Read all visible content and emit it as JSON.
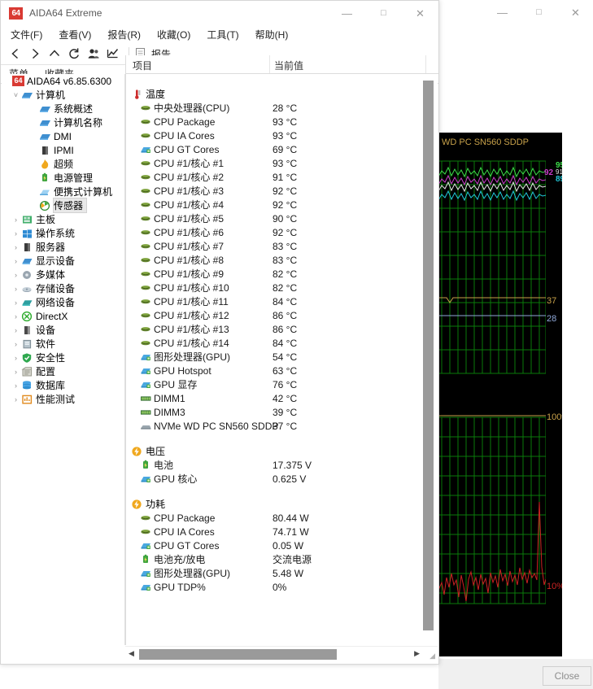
{
  "app_window": {
    "title": "AIDA64 Extreme",
    "icon_badge": "64",
    "window_controls": {
      "minimize": "minimize-icon",
      "maximize": "maximize-icon",
      "close": "close-icon"
    },
    "menubar": [
      "文件(F)",
      "查看(V)",
      "报告(R)",
      "收藏(O)",
      "工具(T)",
      "帮助(H)"
    ],
    "toolbar": {
      "buttons": [
        "back-icon",
        "forward-icon",
        "up-icon",
        "refresh-icon",
        "user-icon",
        "chart-icon"
      ],
      "report_label": "报告"
    },
    "tabs": [
      "菜单",
      "收藏夹"
    ],
    "columns": [
      "项目",
      "当前值"
    ]
  },
  "sidebar": {
    "root": {
      "label": "AIDA64 v6.85.6300",
      "badge": "64"
    },
    "items": [
      {
        "label": "计算机",
        "indent": 1,
        "twisty": "expanded",
        "icon": "computer-icon",
        "selected": false
      },
      {
        "label": "系统概述",
        "indent": 3,
        "twisty": "",
        "icon": "computer-icon",
        "selected": false
      },
      {
        "label": "计算机名称",
        "indent": 3,
        "twisty": "",
        "icon": "computer-icon",
        "selected": false
      },
      {
        "label": "DMI",
        "indent": 3,
        "twisty": "",
        "icon": "computer-icon",
        "selected": false
      },
      {
        "label": "IPMI",
        "indent": 3,
        "twisty": "",
        "icon": "server-icon",
        "selected": false
      },
      {
        "label": "超频",
        "indent": 3,
        "twisty": "",
        "icon": "flame-icon",
        "selected": false
      },
      {
        "label": "电源管理",
        "indent": 3,
        "twisty": "",
        "icon": "battery-icon",
        "selected": false
      },
      {
        "label": "便携式计算机",
        "indent": 3,
        "twisty": "",
        "icon": "laptop-icon",
        "selected": false
      },
      {
        "label": "传感器",
        "indent": 3,
        "twisty": "",
        "icon": "sensor-icon",
        "selected": true
      },
      {
        "label": "主板",
        "indent": 1,
        "twisty": "collapsed",
        "icon": "mainboard-icon",
        "selected": false
      },
      {
        "label": "操作系统",
        "indent": 1,
        "twisty": "collapsed",
        "icon": "windows-icon",
        "selected": false
      },
      {
        "label": "服务器",
        "indent": 1,
        "twisty": "collapsed",
        "icon": "server-icon",
        "selected": false
      },
      {
        "label": "显示设备",
        "indent": 1,
        "twisty": "collapsed",
        "icon": "display-icon",
        "selected": false
      },
      {
        "label": "多媒体",
        "indent": 1,
        "twisty": "collapsed",
        "icon": "audio-icon",
        "selected": false
      },
      {
        "label": "存储设备",
        "indent": 1,
        "twisty": "collapsed",
        "icon": "storage-icon",
        "selected": false
      },
      {
        "label": "网络设备",
        "indent": 1,
        "twisty": "collapsed",
        "icon": "network-icon",
        "selected": false
      },
      {
        "label": "DirectX",
        "indent": 1,
        "twisty": "collapsed",
        "icon": "directx-icon",
        "selected": false
      },
      {
        "label": "设备",
        "indent": 1,
        "twisty": "collapsed",
        "icon": "device-icon",
        "selected": false
      },
      {
        "label": "软件",
        "indent": 1,
        "twisty": "collapsed",
        "icon": "software-icon",
        "selected": false
      },
      {
        "label": "安全性",
        "indent": 1,
        "twisty": "collapsed",
        "icon": "shield-icon",
        "selected": false
      },
      {
        "label": "配置",
        "indent": 1,
        "twisty": "collapsed",
        "icon": "config-icon",
        "selected": false
      },
      {
        "label": "数据库",
        "indent": 1,
        "twisty": "collapsed",
        "icon": "database-icon",
        "selected": false
      },
      {
        "label": "性能测试",
        "indent": 1,
        "twisty": "collapsed",
        "icon": "benchmark-icon",
        "selected": false
      }
    ]
  },
  "sensor_list": [
    {
      "group": "温度",
      "group_icon": "thermometer-icon",
      "rows": [
        {
          "name": "中央处理器(CPU)",
          "value": "28 °C",
          "icon": "cpu-icon"
        },
        {
          "name": "CPU Package",
          "value": "93 °C",
          "icon": "cpu-icon"
        },
        {
          "name": "CPU IA Cores",
          "value": "93 °C",
          "icon": "cpu-icon"
        },
        {
          "name": "CPU GT Cores",
          "value": "69 °C",
          "icon": "gpu-icon"
        },
        {
          "name": "CPU #1/核心 #1",
          "value": "93 °C",
          "icon": "cpu-icon"
        },
        {
          "name": "CPU #1/核心 #2",
          "value": "91 °C",
          "icon": "cpu-icon"
        },
        {
          "name": "CPU #1/核心 #3",
          "value": "92 °C",
          "icon": "cpu-icon"
        },
        {
          "name": "CPU #1/核心 #4",
          "value": "92 °C",
          "icon": "cpu-icon"
        },
        {
          "name": "CPU #1/核心 #5",
          "value": "90 °C",
          "icon": "cpu-icon"
        },
        {
          "name": "CPU #1/核心 #6",
          "value": "92 °C",
          "icon": "cpu-icon"
        },
        {
          "name": "CPU #1/核心 #7",
          "value": "83 °C",
          "icon": "cpu-icon"
        },
        {
          "name": "CPU #1/核心 #8",
          "value": "83 °C",
          "icon": "cpu-icon"
        },
        {
          "name": "CPU #1/核心 #9",
          "value": "82 °C",
          "icon": "cpu-icon"
        },
        {
          "name": "CPU #1/核心 #10",
          "value": "82 °C",
          "icon": "cpu-icon"
        },
        {
          "name": "CPU #1/核心 #11",
          "value": "84 °C",
          "icon": "cpu-icon"
        },
        {
          "name": "CPU #1/核心 #12",
          "value": "86 °C",
          "icon": "cpu-icon"
        },
        {
          "name": "CPU #1/核心 #13",
          "value": "86 °C",
          "icon": "cpu-icon"
        },
        {
          "name": "CPU #1/核心 #14",
          "value": "84 °C",
          "icon": "cpu-icon"
        },
        {
          "name": "图形处理器(GPU)",
          "value": "54 °C",
          "icon": "gpu-icon"
        },
        {
          "name": "GPU Hotspot",
          "value": "63 °C",
          "icon": "gpu-icon"
        },
        {
          "name": "GPU 显存",
          "value": "76 °C",
          "icon": "gpu-icon"
        },
        {
          "name": "DIMM1",
          "value": "42 °C",
          "icon": "memory-icon"
        },
        {
          "name": "DIMM3",
          "value": "39 °C",
          "icon": "memory-icon"
        },
        {
          "name": "NVMe WD PC SN560 SDDP",
          "value": "37 °C",
          "icon": "disk-icon"
        }
      ]
    },
    {
      "group": "电压",
      "group_icon": "voltage-icon",
      "rows": [
        {
          "name": "电池",
          "value": "17.375 V",
          "icon": "battery-icon"
        },
        {
          "name": "GPU 核心",
          "value": "0.625 V",
          "icon": "gpu-icon"
        }
      ]
    },
    {
      "group": "功耗",
      "group_icon": "voltage-icon",
      "rows": [
        {
          "name": "CPU Package",
          "value": "80.44 W",
          "icon": "cpu-icon"
        },
        {
          "name": "CPU IA Cores",
          "value": "74.71 W",
          "icon": "cpu-icon"
        },
        {
          "name": "CPU GT Cores",
          "value": "0.05 W",
          "icon": "gpu-icon"
        },
        {
          "name": "电池充/放电",
          "value": "交流电源",
          "icon": "battery-icon"
        },
        {
          "name": "图形处理器(GPU)",
          "value": "5.48 W",
          "icon": "gpu-icon"
        },
        {
          "name": "GPU TDP%",
          "value": "0%",
          "icon": "gpu-icon"
        }
      ]
    }
  ],
  "back_window": {
    "window_controls": {
      "minimize": "minimize-icon",
      "maximize": "maximize-icon",
      "close": "close-icon"
    },
    "close_button": "Close",
    "graph_title": "WD PC SN560 SDDP",
    "graphs": [
      {
        "name": "temperature-graph",
        "labels": [
          {
            "text": "95",
            "color": "#3ddc4a"
          },
          {
            "text": "92",
            "color": "#cc3ccc"
          },
          {
            "text": "91",
            "color": "#e8e8e8"
          },
          {
            "text": "89",
            "color": "#22c8d8"
          },
          {
            "text": "37",
            "color": "#c8a24a"
          },
          {
            "text": "28",
            "color": "#8fa8d8"
          }
        ]
      },
      {
        "name": "usage-graph",
        "labels": [
          {
            "text": "100%",
            "color": "#c8a24a"
          },
          {
            "text": "10%",
            "color": "#cc2222"
          }
        ]
      }
    ]
  },
  "colors": {
    "accent_red": "#d93a33",
    "graph_bg": "#000000",
    "graph_grid": "#0a7a0a"
  },
  "chart_data": [
    {
      "type": "line",
      "title": "WD PC SN560 SDDP",
      "ylabel": "°C",
      "grid": true,
      "legend": "right-inline",
      "ylim": [
        0,
        105
      ],
      "series": [
        {
          "name": "95",
          "color": "#3ddc4a",
          "last_value": 95,
          "style": "noisy",
          "mean": 94,
          "amp": 4
        },
        {
          "name": "92",
          "color": "#cc3ccc",
          "last_value": 92,
          "style": "noisy",
          "mean": 91,
          "amp": 3
        },
        {
          "name": "91",
          "color": "#e8e8e8",
          "last_value": 91,
          "style": "noisy",
          "mean": 90,
          "amp": 3
        },
        {
          "name": "89",
          "color": "#22c8d8",
          "last_value": 89,
          "style": "noisy",
          "mean": 88,
          "amp": 3
        },
        {
          "name": "37",
          "color": "#c8a24a",
          "last_value": 37,
          "style": "flat",
          "mean": 37,
          "amp": 0
        },
        {
          "name": "28",
          "color": "#8fa8d8",
          "last_value": 28,
          "style": "flat",
          "mean": 28,
          "amp": 0
        }
      ]
    },
    {
      "type": "line",
      "title": "",
      "ylabel": "%",
      "grid": true,
      "ylim": [
        0,
        100
      ],
      "series": [
        {
          "name": "100%",
          "color": "#c8a24a",
          "last_value": 100,
          "style": "flat",
          "mean": 100,
          "amp": 0
        },
        {
          "name": "10%",
          "color": "#cc2222",
          "last_value": 10,
          "style": "noisy",
          "mean": 9,
          "amp": 8,
          "spike": 45
        }
      ]
    }
  ]
}
